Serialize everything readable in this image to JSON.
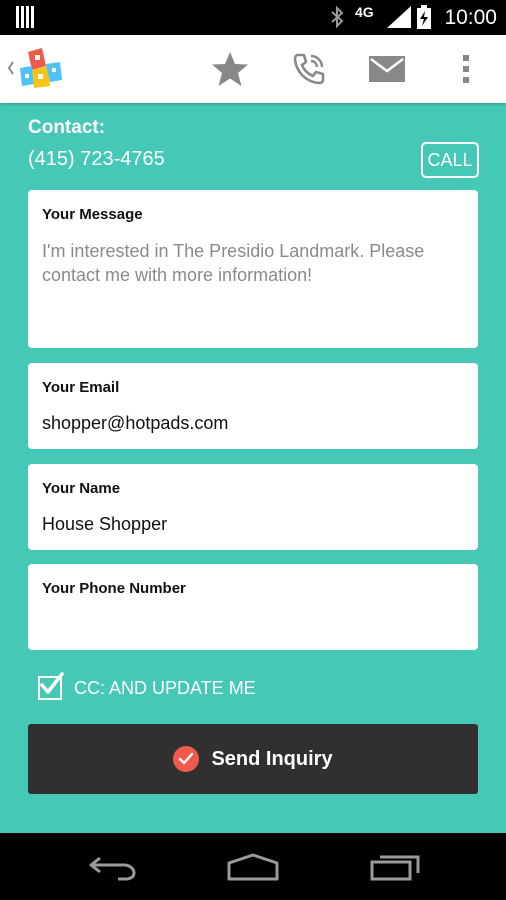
{
  "status_bar": {
    "time": "10:00",
    "network": "4G",
    "icons": [
      "bars-icon",
      "bluetooth-icon",
      "signal-icon",
      "battery-icon"
    ]
  },
  "action_bar": {
    "icons": [
      "back-chevron-icon",
      "app-logo-icon",
      "star-icon",
      "phone-icon",
      "mail-icon",
      "overflow-menu-icon"
    ]
  },
  "contact": {
    "label": "Contact:",
    "phone": "(415) 723-4765",
    "call_label": "CALL"
  },
  "form": {
    "message": {
      "label": "Your Message",
      "placeholder": "I'm interested in The Presidio Landmark. Please contact me with more information!"
    },
    "email": {
      "label": "Your Email",
      "value": "shopper@hotpads.com"
    },
    "name": {
      "label": "Your Name",
      "value": "House Shopper"
    },
    "phone": {
      "label": "Your Phone Number",
      "value": ""
    },
    "cc": {
      "label": "CC: AND UPDATE ME",
      "checked": true
    },
    "send_label": "Send Inquiry"
  },
  "colors": {
    "background": "#46c8b7",
    "button": "#303030",
    "accent": "#f05a4b"
  },
  "nav_bar": {
    "icons": [
      "back-icon",
      "home-icon",
      "recents-icon"
    ]
  }
}
